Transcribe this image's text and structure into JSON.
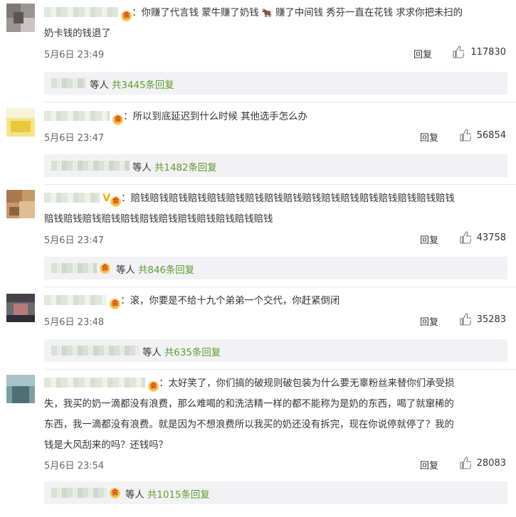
{
  "comments": [
    {
      "text": "：你赚了代言钱 蒙牛赚了奶钱 ",
      "text2": " 赚了中间钱 秀芬一直在花钱 求求你把未扫的",
      "text3": "奶卡钱的钱退了",
      "time": "5月6日 23:49",
      "reply_label": "回复",
      "likes": "117830",
      "sub_prefix": "等人",
      "sub_link": "共3445条回复",
      "icon": "cow-emoji"
    },
    {
      "text": "：所以到底延迟到什么时候 其他选手怎么办",
      "time": "5月6日 23:47",
      "reply_label": "回复",
      "likes": "56854",
      "sub_prefix": "等人",
      "sub_link": "共1482条回复"
    },
    {
      "text": "：赔钱赔钱赔钱赔钱赔钱赔钱赔钱赔钱赔钱赔钱赔钱赔钱赔钱赔钱赔钱赔钱赔钱",
      "text2": "赔钱赔钱赔钱赔钱赔钱赔钱赔钱赔钱赔钱赔钱赔钱赔钱",
      "time": "5月6日 23:47",
      "reply_label": "回复",
      "likes": "43758",
      "sub_prefix": "等人",
      "sub_link": "共846条回复",
      "badge": "V"
    },
    {
      "text": "：滚，你要是不给十九个弟弟一个交代，你赶紧倒闭",
      "time": "5月6日 23:48",
      "reply_label": "回复",
      "likes": "35283",
      "sub_prefix": "等人",
      "sub_link": "共635条回复"
    },
    {
      "text": "：太好笑了，你们搞的破规则破包装为什么要无辜粉丝来替你们承受损",
      "text2": "失，我买的奶一滴都没有浪费，那么难喝的和洗洁精一样的都不能称为是奶的东西，喝了就窜稀的",
      "text3": "东西，我一滴都没有浪费。就是因为不想浪费所以我买的奶还没有拆完，现在你说停就停了？我的",
      "text4": "钱是大风刮来的吗？还钱吗？",
      "time": "5月6日 23:54",
      "reply_label": "回复",
      "likes": "28083",
      "sub_prefix": "等人",
      "sub_link": "共1015条回复"
    }
  ],
  "colors": {
    "link_green": "#5f9a2d",
    "vip_gold": "#e8b43a",
    "v_badge": "#f0a800"
  },
  "icons": {
    "like": "thumbs-up-icon",
    "vip": "vip-crown-icon"
  }
}
